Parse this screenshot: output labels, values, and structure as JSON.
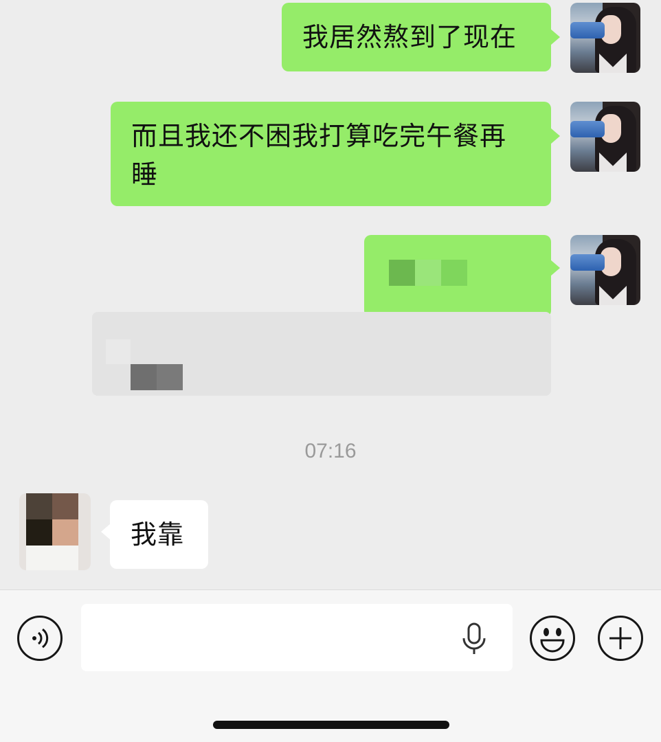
{
  "messages": [
    {
      "sender": "me",
      "text": "我居然熬到了现在"
    },
    {
      "sender": "me",
      "text": "而且我还不困我打算吃完午餐再睡"
    },
    {
      "sender": "me",
      "text": "",
      "censored": true,
      "has_quote": true
    },
    {
      "sender": "other",
      "text": "我靠"
    }
  ],
  "timestamp": "07:16",
  "input": {
    "value": "",
    "placeholder": ""
  },
  "icons": {
    "voice": "voice-mode-icon",
    "mic": "microphone-icon",
    "emoji": "emoji-icon",
    "plus": "plus-icon"
  },
  "colors": {
    "my_bubble": "#95ec69",
    "their_bubble": "#ffffff",
    "background": "#ededed"
  }
}
